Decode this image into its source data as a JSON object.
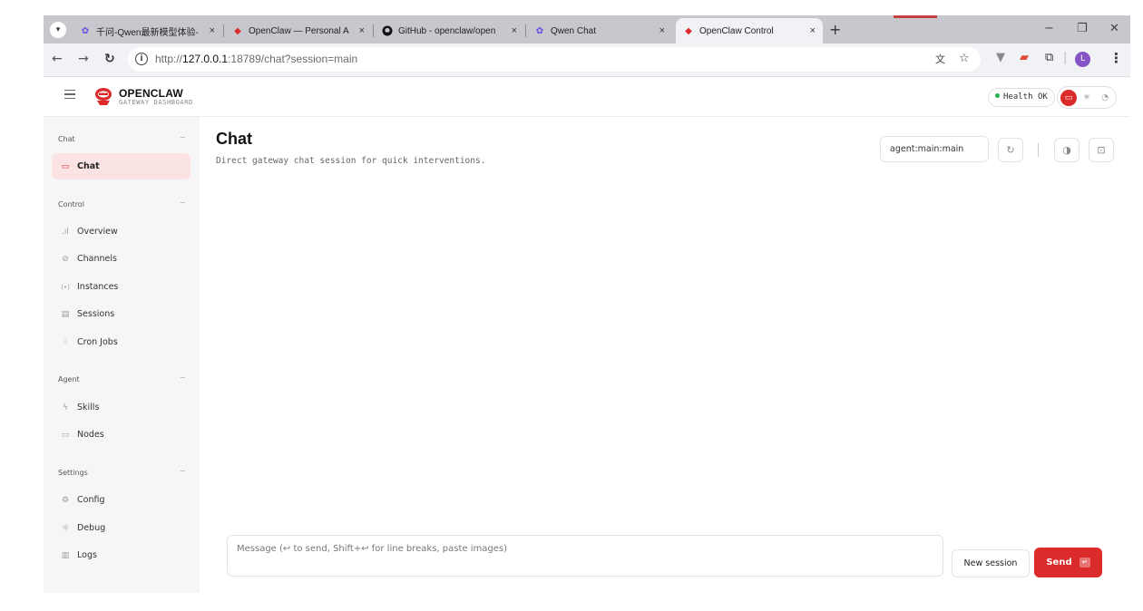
{
  "browser": {
    "tabs": [
      {
        "title": "千问-Qwen最新模型体验-",
        "icon": "qwen-icon"
      },
      {
        "title": "OpenClaw — Personal A",
        "icon": "openclaw-icon"
      },
      {
        "title": "GitHub - openclaw/open",
        "icon": "github-icon"
      },
      {
        "title": "Qwen Chat",
        "icon": "qwen-icon"
      },
      {
        "title": "OpenClaw Control",
        "icon": "openclaw-icon",
        "active": true
      }
    ],
    "new_tab": "+",
    "close_glyph": "×",
    "window_controls": {
      "minimize": "−",
      "restore": "❐",
      "close": "✕"
    },
    "url_prefix": "http://",
    "url_host": "127.0.0.1",
    "url_rest": ":18789/chat?session=main",
    "profile_initial": "L"
  },
  "header": {
    "brand": "OPENCLAW",
    "brand_sub": "GATEWAY DASHBOARD",
    "health_label": "Health",
    "health_value": "OK"
  },
  "sidebar": {
    "groups": [
      {
        "label": "Chat",
        "collapse": "−",
        "items": [
          {
            "label": "Chat",
            "icon": "chat-icon",
            "active": true
          }
        ]
      },
      {
        "label": "Control",
        "collapse": "−",
        "items": [
          {
            "label": "Overview",
            "icon": "bar-chart-icon"
          },
          {
            "label": "Channels",
            "icon": "link-icon"
          },
          {
            "label": "Instances",
            "icon": "radio-icon"
          },
          {
            "label": "Sessions",
            "icon": "file-icon"
          },
          {
            "label": "Cron Jobs",
            "icon": "loader-icon"
          }
        ]
      },
      {
        "label": "Agent",
        "collapse": "−",
        "items": [
          {
            "label": "Skills",
            "icon": "zap-icon"
          },
          {
            "label": "Nodes",
            "icon": "monitor-icon"
          }
        ]
      },
      {
        "label": "Settings",
        "collapse": "−",
        "items": [
          {
            "label": "Config",
            "icon": "gear-icon"
          },
          {
            "label": "Debug",
            "icon": "bug-icon"
          },
          {
            "label": "Logs",
            "icon": "scroll-icon"
          }
        ]
      }
    ]
  },
  "main": {
    "title": "Chat",
    "subtitle": "Direct gateway chat session for quick interventions.",
    "session_key": "agent:main:main",
    "composer_placeholder": "Message (↩ to send, Shift+↩ for line breaks, paste images)",
    "new_session_label": "New session",
    "send_label": "Send",
    "send_kbd": "↵"
  },
  "colors": {
    "accent": "#dc2b2b",
    "health_dot": "#22b14c",
    "sidebar_bg": "#f6f6f6",
    "active_item_bg": "#fbe3e3"
  }
}
